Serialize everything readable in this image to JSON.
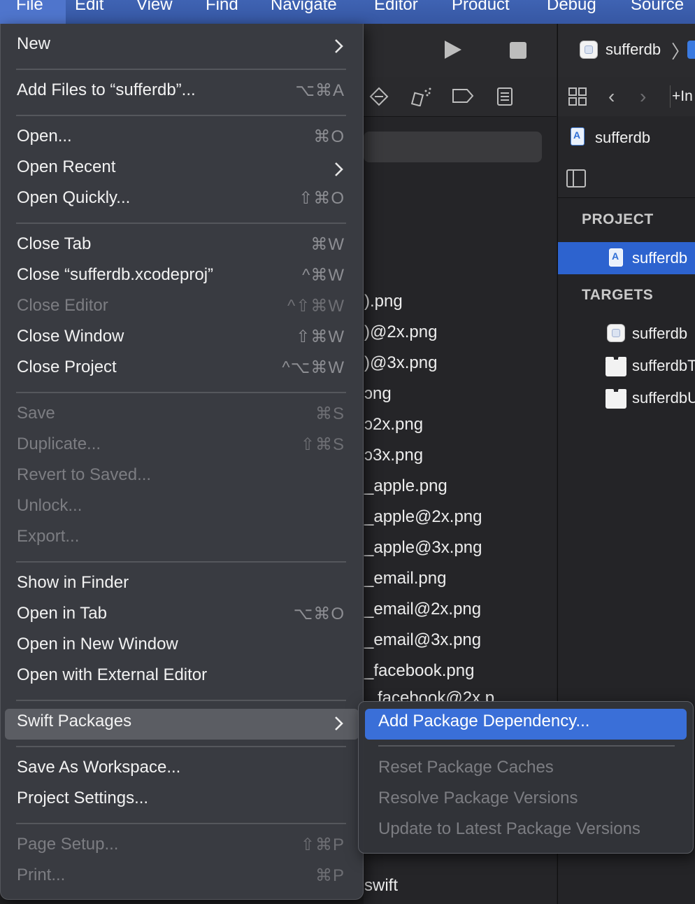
{
  "menubar": {
    "items": [
      "File",
      "Edit",
      "View",
      "Find",
      "Navigate",
      "Editor",
      "Product",
      "Debug",
      "Source"
    ]
  },
  "file_menu": {
    "new": "New",
    "add_files": "Add Files to “sufferdb”...",
    "add_files_sc": "⌥⌘A",
    "open": "Open...",
    "open_sc": "⌘O",
    "open_recent": "Open Recent",
    "open_quickly": "Open Quickly...",
    "open_quickly_sc": "⇧⌘O",
    "close_tab": "Close Tab",
    "close_tab_sc": "⌘W",
    "close_project_file": "Close “sufferdb.xcodeproj”",
    "close_project_file_sc": "^⌘W",
    "close_editor": "Close Editor",
    "close_editor_sc": "^⇧⌘W",
    "close_window": "Close Window",
    "close_window_sc": "⇧⌘W",
    "close_project": "Close Project",
    "close_project_sc": "^⌥⌘W",
    "save": "Save",
    "save_sc": "⌘S",
    "duplicate": "Duplicate...",
    "duplicate_sc": "⇧⌘S",
    "revert": "Revert to Saved...",
    "unlock": "Unlock...",
    "export": "Export...",
    "show_in_finder": "Show in Finder",
    "open_in_tab": "Open in Tab",
    "open_in_tab_sc": "⌥⌘O",
    "open_new_window": "Open in New Window",
    "open_external": "Open with External Editor",
    "swift_packages": "Swift Packages",
    "save_as_workspace": "Save As Workspace...",
    "project_settings": "Project Settings...",
    "page_setup": "Page Setup...",
    "page_setup_sc": "⇧⌘P",
    "print": "Print...",
    "print_sc": "⌘P"
  },
  "submenu": {
    "add_dependency": "Add Package Dependency...",
    "reset_caches": "Reset Package Caches",
    "resolve_versions": "Resolve Package Versions",
    "update_latest": "Update to Latest Package Versions"
  },
  "file_list": [
    ").png",
    ")@2x.png",
    ")@3x.png",
    "ɔng",
    "ɔ2x.png",
    "ɔ3x.png",
    "_apple.png",
    "_apple@2x.png",
    "_apple@3x.png",
    "_email.png",
    "_email@2x.png",
    "_email@3x.png",
    "_facebook.png",
    "facebook@2x.p",
    "swift"
  ],
  "right_panel": {
    "scheme": "sufferdb",
    "add_label": "+In",
    "breadcrumb": "sufferdb",
    "project_header": "PROJECT",
    "project_item": "sufferdb",
    "targets_header": "TARGETS",
    "targets": [
      "sufferdb",
      "sufferdbT",
      "sufferdbU"
    ]
  },
  "colors": {
    "menubar": "#3657a3",
    "selection": "#3a6fd8",
    "menu_bg": "#3a3c42"
  }
}
